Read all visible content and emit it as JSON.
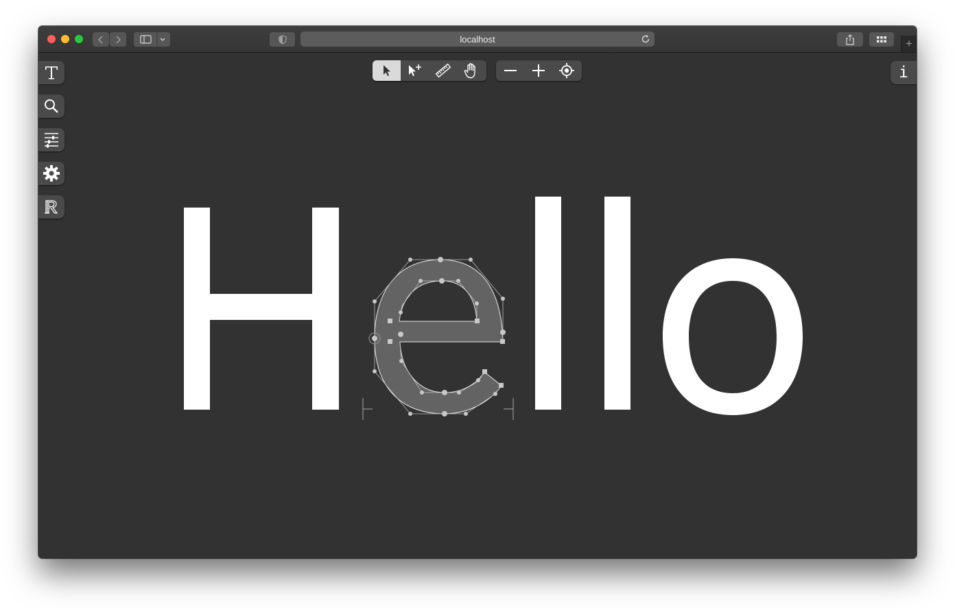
{
  "browser": {
    "url": "localhost",
    "new_tab_label": "+"
  },
  "toolbar": {
    "tools": [
      {
        "name": "pointer-tool",
        "active": true
      },
      {
        "name": "point-add-tool",
        "active": false
      },
      {
        "name": "ruler-tool",
        "active": false
      },
      {
        "name": "hand-tool",
        "active": false
      }
    ],
    "zoom": [
      "zoom-out",
      "zoom-in",
      "zoom-to-fit"
    ]
  },
  "sidebar": {
    "items": [
      {
        "name": "text-entry",
        "icon": "text-T-icon"
      },
      {
        "name": "glyph-search",
        "icon": "search-icon"
      },
      {
        "name": "font-sources",
        "icon": "sliders-icon"
      },
      {
        "name": "settings",
        "icon": "gear-icon"
      },
      {
        "name": "references",
        "icon": "reference-R-icon"
      }
    ]
  },
  "info_button_label": "i",
  "editor": {
    "text": [
      "H",
      "e",
      "l",
      "l",
      "o"
    ],
    "selected_glyph": "e"
  },
  "colors": {
    "canvas_bg": "#323232",
    "glyph_fill": "#ffffff",
    "selected_glyph_fill": "#636363",
    "active_tool_bg": "#dadada"
  }
}
